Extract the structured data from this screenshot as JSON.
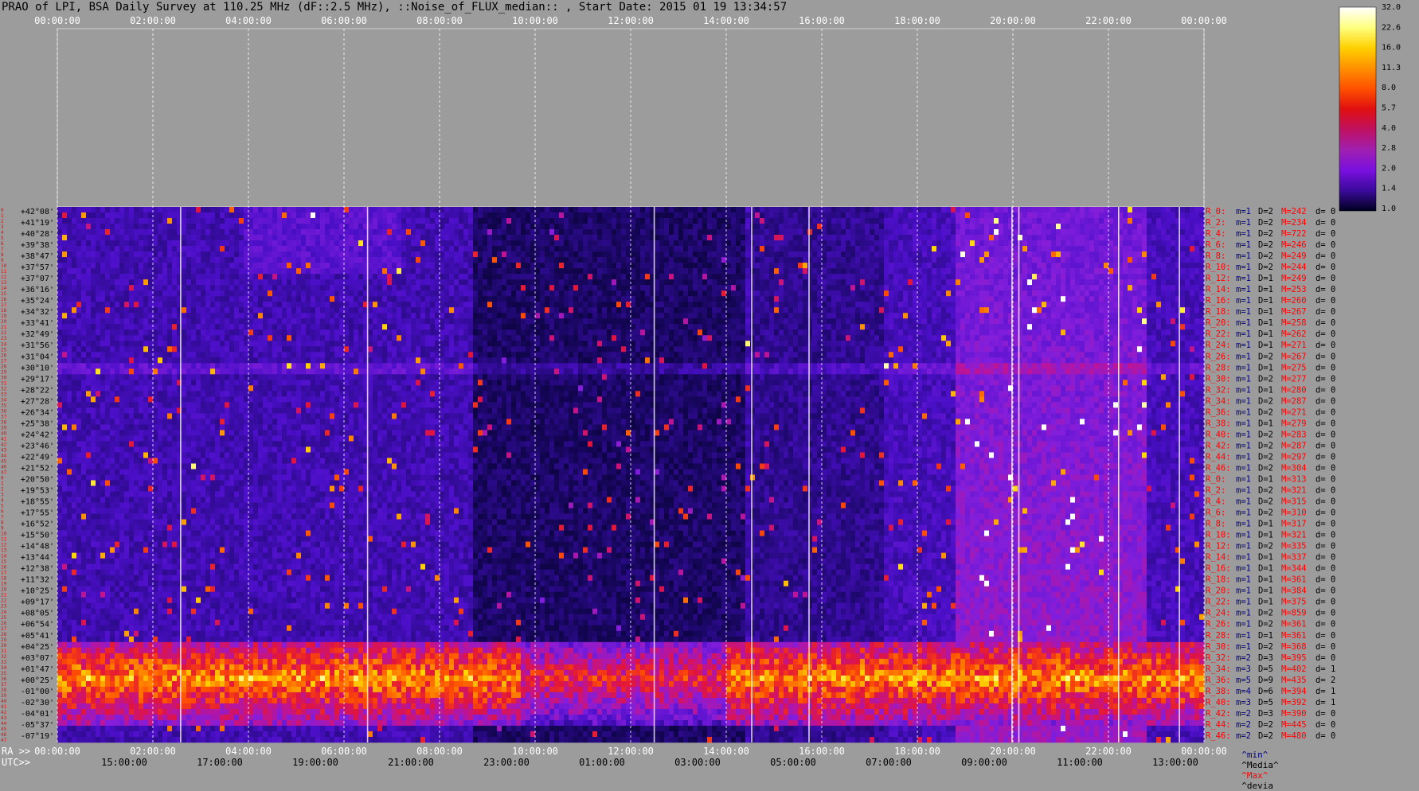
{
  "title": "PRAO of LPI, BSA Daily Survey at 110.25 MHz (dF::2.5 MHz), ::Noise_of_FLUX_median:: , Start Date: 2015 01 19 13:34:57",
  "chart_data": {
    "type": "heatmap",
    "top_axis_labels": [
      "00:00:00",
      "02:00:00",
      "04:00:00",
      "06:00:00",
      "08:00:00",
      "10:00:00",
      "12:00:00",
      "14:00:00",
      "16:00:00",
      "18:00:00",
      "20:00:00",
      "22:00:00",
      "00:00:00"
    ],
    "ra_axis_prefix": "RA >>",
    "ra_axis_labels": [
      "00:00:00",
      "02:00:00",
      "04:00:00",
      "06:00:00",
      "08:00:00",
      "10:00:00",
      "12:00:00",
      "14:00:00",
      "16:00:00",
      "18:00:00",
      "20:00:00",
      "22:00:00",
      "00:00:00"
    ],
    "utc_axis_prefix": "UTC>>",
    "utc_axis_labels": [
      "15:00:00",
      "17:00:00",
      "19:00:00",
      "21:00:00",
      "23:00:00",
      "01:00:00",
      "03:00:00",
      "05:00:00",
      "07:00:00",
      "09:00:00",
      "11:00:00",
      "13:00:00"
    ],
    "colorbar_ticks": [
      "32.0",
      "22.6",
      "16.0",
      "11.3",
      "8.0",
      "5.7",
      "4.0",
      "2.8",
      "2.0",
      "1.4",
      "1.0"
    ],
    "colorbar_colors": [
      "#ffffff",
      "#ffff80",
      "#ffd000",
      "#ff9000",
      "#ff5000",
      "#e01010",
      "#c01060",
      "#a020b0",
      "#7a10e0",
      "#3a0a9a",
      "#000020"
    ],
    "declinations": [
      "+42°08'",
      "+41°19'",
      "+40°28'",
      "+39°38'",
      "+38°47'",
      "+37°57'",
      "+37°07'",
      "+36°16'",
      "+35°24'",
      "+34°32'",
      "+33°41'",
      "+32°49'",
      "+31°56'",
      "+31°04'",
      "+30°10'",
      "+29°17'",
      "+28°22'",
      "+27°28'",
      "+26°34'",
      "+25°38'",
      "+24°42'",
      "+23°46'",
      "+22°49'",
      "+21°52'",
      "+20°50'",
      "+19°53'",
      "+18°55'",
      "+17°55'",
      "+16°52'",
      "+15°50'",
      "+14°48'",
      "+13°44'",
      "+12°38'",
      "+11°32'",
      "+10°25'",
      "+09°17'",
      "+08°05'",
      "+06°54'",
      "+05°41'",
      "+04°25'",
      "+03°07'",
      "+01°47'",
      "+00°25'",
      "-01°00'",
      "-02°30'",
      "-04°01'",
      "-05°37'",
      "-07°19'"
    ],
    "row_index_labels": [
      "0",
      "1",
      "2",
      "3",
      "4",
      "5",
      "6",
      "7",
      "8",
      "9",
      "10",
      "11",
      "12",
      "13",
      "14",
      "15",
      "16",
      "17",
      "18",
      "19",
      "20",
      "21",
      "22",
      "23",
      "24",
      "25",
      "26",
      "27",
      "28",
      "29",
      "30",
      "31",
      "32",
      "33",
      "34",
      "35",
      "36",
      "37",
      "38",
      "39",
      "40",
      "41",
      "42",
      "43",
      "44",
      "45",
      "46",
      "47",
      "0",
      "1",
      "2",
      "3",
      "4",
      "5",
      "6",
      "7",
      "8",
      "9",
      "10",
      "11",
      "12",
      "13",
      "14",
      "15",
      "16",
      "17",
      "18",
      "19",
      "20",
      "21",
      "22",
      "23",
      "24",
      "25",
      "26",
      "27",
      "28",
      "29",
      "30",
      "31",
      "32",
      "33",
      "34",
      "35",
      "36",
      "37",
      "38",
      "39",
      "40",
      "41",
      "42",
      "43",
      "44",
      "45",
      "46",
      "47"
    ],
    "beam_stats": [
      {
        "r": "R_0:",
        "m": "m=1",
        "d": "D=2",
        "M": "M=242",
        "dv": "d= 0"
      },
      {
        "r": "R_2:",
        "m": "m=1",
        "d": "D=2",
        "M": "M=234",
        "dv": "d= 0"
      },
      {
        "r": "R_4:",
        "m": "m=1",
        "d": "D=2",
        "M": "M=722",
        "dv": "d= 0"
      },
      {
        "r": "R_6:",
        "m": "m=1",
        "d": "D=2",
        "M": "M=246",
        "dv": "d= 0"
      },
      {
        "r": "R_8:",
        "m": "m=1",
        "d": "D=2",
        "M": "M=249",
        "dv": "d= 0"
      },
      {
        "r": "R_10:",
        "m": "m=1",
        "d": "D=2",
        "M": "M=244",
        "dv": "d= 0"
      },
      {
        "r": "R_12:",
        "m": "m=1",
        "d": "D=1",
        "M": "M=249",
        "dv": "d= 0"
      },
      {
        "r": "R_14:",
        "m": "m=1",
        "d": "D=1",
        "M": "M=253",
        "dv": "d= 0"
      },
      {
        "r": "R_16:",
        "m": "m=1",
        "d": "D=1",
        "M": "M=260",
        "dv": "d= 0"
      },
      {
        "r": "R_18:",
        "m": "m=1",
        "d": "D=1",
        "M": "M=267",
        "dv": "d= 0"
      },
      {
        "r": "R_20:",
        "m": "m=1",
        "d": "D=1",
        "M": "M=258",
        "dv": "d= 0"
      },
      {
        "r": "R_22:",
        "m": "m=1",
        "d": "D=1",
        "M": "M=262",
        "dv": "d= 0"
      },
      {
        "r": "R_24:",
        "m": "m=1",
        "d": "D=1",
        "M": "M=271",
        "dv": "d= 0"
      },
      {
        "r": "R_26:",
        "m": "m=1",
        "d": "D=2",
        "M": "M=267",
        "dv": "d= 0"
      },
      {
        "r": "R_28:",
        "m": "m=1",
        "d": "D=1",
        "M": "M=275",
        "dv": "d= 0"
      },
      {
        "r": "R_30:",
        "m": "m=1",
        "d": "D=2",
        "M": "M=277",
        "dv": "d= 0"
      },
      {
        "r": "R_32:",
        "m": "m=1",
        "d": "D=1",
        "M": "M=280",
        "dv": "d= 0"
      },
      {
        "r": "R_34:",
        "m": "m=1",
        "d": "D=2",
        "M": "M=287",
        "dv": "d= 0"
      },
      {
        "r": "R_36:",
        "m": "m=1",
        "d": "D=2",
        "M": "M=271",
        "dv": "d= 0"
      },
      {
        "r": "R_38:",
        "m": "m=1",
        "d": "D=1",
        "M": "M=279",
        "dv": "d= 0"
      },
      {
        "r": "R_40:",
        "m": "m=1",
        "d": "D=2",
        "M": "M=283",
        "dv": "d= 0"
      },
      {
        "r": "R_42:",
        "m": "m=1",
        "d": "D=2",
        "M": "M=287",
        "dv": "d= 0"
      },
      {
        "r": "R_44:",
        "m": "m=1",
        "d": "D=2",
        "M": "M=297",
        "dv": "d= 0"
      },
      {
        "r": "R_46:",
        "m": "m=1",
        "d": "D=2",
        "M": "M=304",
        "dv": "d= 0"
      },
      {
        "r": "R_0:",
        "m": "m=1",
        "d": "D=1",
        "M": "M=313",
        "dv": "d= 0"
      },
      {
        "r": "R_2:",
        "m": "m=1",
        "d": "D=2",
        "M": "M=321",
        "dv": "d= 0"
      },
      {
        "r": "R_4:",
        "m": "m=1",
        "d": "D=2",
        "M": "M=315",
        "dv": "d= 0"
      },
      {
        "r": "R_6:",
        "m": "m=1",
        "d": "D=2",
        "M": "M=310",
        "dv": "d= 0"
      },
      {
        "r": "R_8:",
        "m": "m=1",
        "d": "D=1",
        "M": "M=317",
        "dv": "d= 0"
      },
      {
        "r": "R_10:",
        "m": "m=1",
        "d": "D=1",
        "M": "M=321",
        "dv": "d= 0"
      },
      {
        "r": "R_12:",
        "m": "m=1",
        "d": "D=2",
        "M": "M=335",
        "dv": "d= 0"
      },
      {
        "r": "R_14:",
        "m": "m=1",
        "d": "D=1",
        "M": "M=337",
        "dv": "d= 0"
      },
      {
        "r": "R_16:",
        "m": "m=1",
        "d": "D=1",
        "M": "M=344",
        "dv": "d= 0"
      },
      {
        "r": "R_18:",
        "m": "m=1",
        "d": "D=1",
        "M": "M=361",
        "dv": "d= 0"
      },
      {
        "r": "R_20:",
        "m": "m=1",
        "d": "D=1",
        "M": "M=384",
        "dv": "d= 0"
      },
      {
        "r": "R_22:",
        "m": "m=1",
        "d": "D=1",
        "M": "M=375",
        "dv": "d= 0"
      },
      {
        "r": "R_24:",
        "m": "m=1",
        "d": "D=2",
        "M": "M=859",
        "dv": "d= 0"
      },
      {
        "r": "R_26:",
        "m": "m=1",
        "d": "D=2",
        "M": "M=361",
        "dv": "d= 0"
      },
      {
        "r": "R_28:",
        "m": "m=1",
        "d": "D=1",
        "M": "M=361",
        "dv": "d= 0"
      },
      {
        "r": "R_30:",
        "m": "m=1",
        "d": "D=2",
        "M": "M=368",
        "dv": "d= 0"
      },
      {
        "r": "R_32:",
        "m": "m=2",
        "d": "D=3",
        "M": "M=395",
        "dv": "d= 0"
      },
      {
        "r": "R_34:",
        "m": "m=3",
        "d": "D=5",
        "M": "M=402",
        "dv": "d= 1"
      },
      {
        "r": "R_36:",
        "m": "m=5",
        "d": "D=9",
        "M": "M=435",
        "dv": "d= 2"
      },
      {
        "r": "R_38:",
        "m": "m=4",
        "d": "D=6",
        "M": "M=394",
        "dv": "d= 1"
      },
      {
        "r": "R_40:",
        "m": "m=3",
        "d": "D=5",
        "M": "M=392",
        "dv": "d= 1"
      },
      {
        "r": "R_42:",
        "m": "m=2",
        "d": "D=3",
        "M": "M=390",
        "dv": "d= 0"
      },
      {
        "r": "R_44:",
        "m": "m=2",
        "d": "D=2",
        "M": "M=445",
        "dv": "d= 0"
      },
      {
        "r": "R_46:",
        "m": "m=2",
        "d": "D=2",
        "M": "M=480",
        "dv": "d= 0"
      }
    ],
    "legend_row": {
      "min": "^min^",
      "median": "^Media^",
      "max": "^Max^",
      "devia": "^devia"
    },
    "colors": {
      "background": "#9c9c9c",
      "min": "#000080",
      "median": "#000000",
      "max": "#ff0000",
      "devia": "#000000",
      "row_label": "#ff0000"
    }
  }
}
